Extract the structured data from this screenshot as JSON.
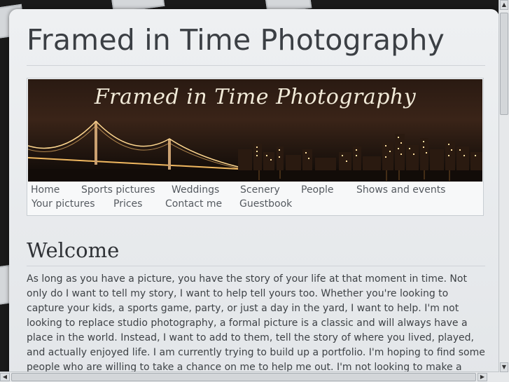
{
  "site": {
    "title": "Framed in Time Photography"
  },
  "banner": {
    "text": "Framed in Time Photography"
  },
  "nav": {
    "row1": [
      "Home",
      "Sports pictures",
      "Weddings",
      "Scenery",
      "People",
      "Shows and events"
    ],
    "row2": [
      "Your pictures",
      "Prices",
      "Contact me",
      "Guestbook"
    ]
  },
  "main": {
    "heading": "Welcome",
    "paragraph": "As long as you have a picture, you have the story of your life at that moment in time. Not only do I want to tell my story, I want to help tell yours too. Whether you're looking to capture your kids, a sports game, party, or just a day in the yard, I want to help. I'm not looking to replace studio photography, a formal picture is a classic and will always have a place in the world. Instead, I want to add to them, tell the story of where you lived, played, and actually enjoyed life. I am currently trying to build up a portfolio. I'm hoping to find some people who are willing to take a chance on me to help me out. I'm not looking to make a fortune. Since I am still somewhat new, I am not looking to jump into wedding"
  },
  "colors": {
    "banner_bg": "#2a1a12",
    "page_bg": "#e6e9ec",
    "text": "#3e4246"
  }
}
